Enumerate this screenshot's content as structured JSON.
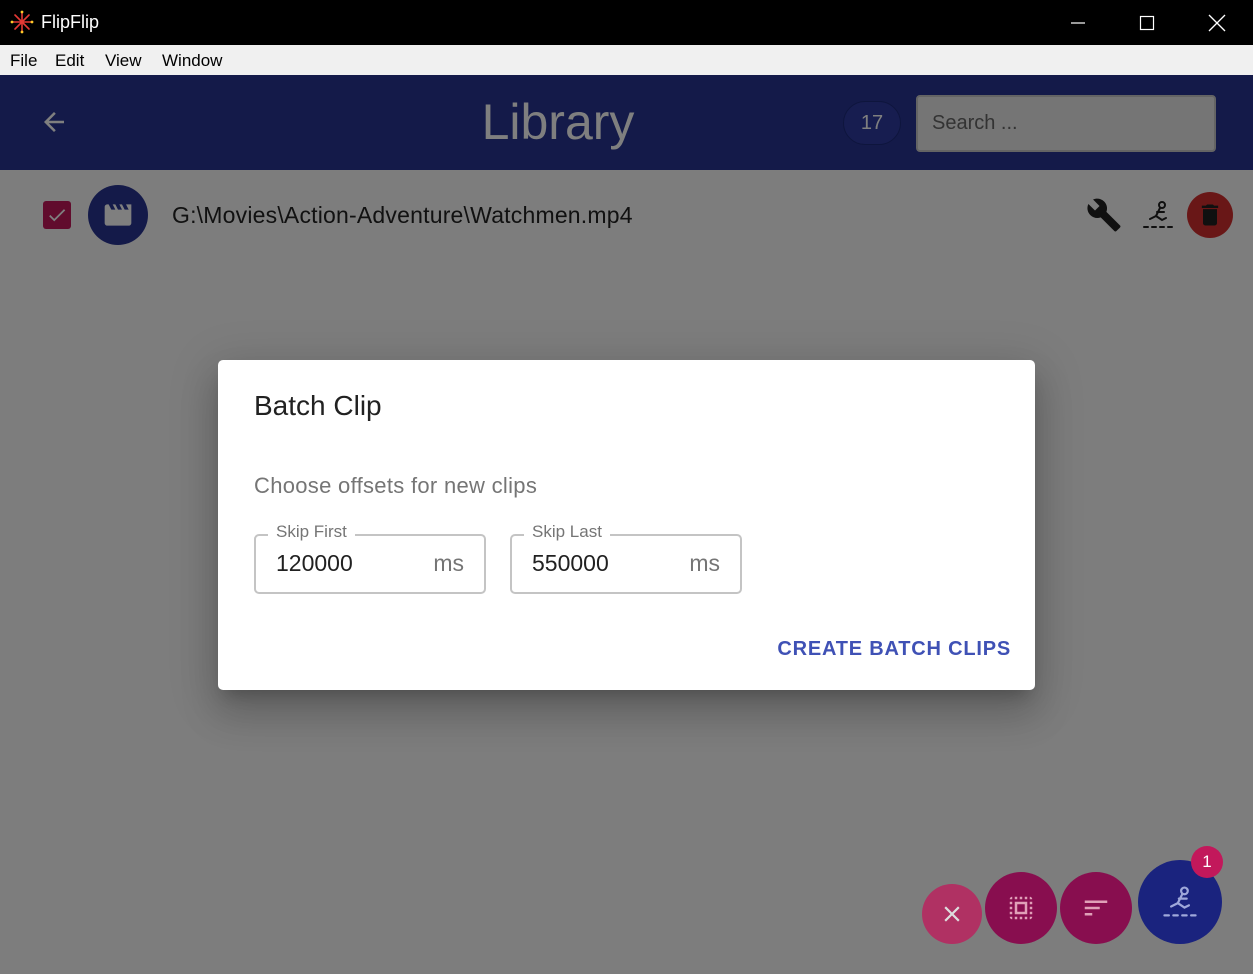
{
  "window": {
    "title": "FlipFlip"
  },
  "menu": {
    "items": [
      "File",
      "Edit",
      "View",
      "Window"
    ]
  },
  "header": {
    "title": "Library",
    "count": "17",
    "search_placeholder": "Search ..."
  },
  "library": {
    "rows": [
      {
        "path": "G:\\Movies\\Action-Adventure\\Watchmen.mp4",
        "checked": true
      }
    ]
  },
  "dialog": {
    "title": "Batch Clip",
    "text": "Choose offsets for new clips",
    "fields": [
      {
        "label": "Skip First",
        "value": "120000",
        "unit": "ms"
      },
      {
        "label": "Skip Last",
        "value": "550000",
        "unit": "ms"
      }
    ],
    "action": "CREATE BATCH CLIPS"
  },
  "fabs": {
    "batch_badge": "1"
  },
  "colors": {
    "primary": "#283593",
    "secondary": "#c2185b",
    "danger": "#d32f2f",
    "action_text": "#3f51b5"
  }
}
